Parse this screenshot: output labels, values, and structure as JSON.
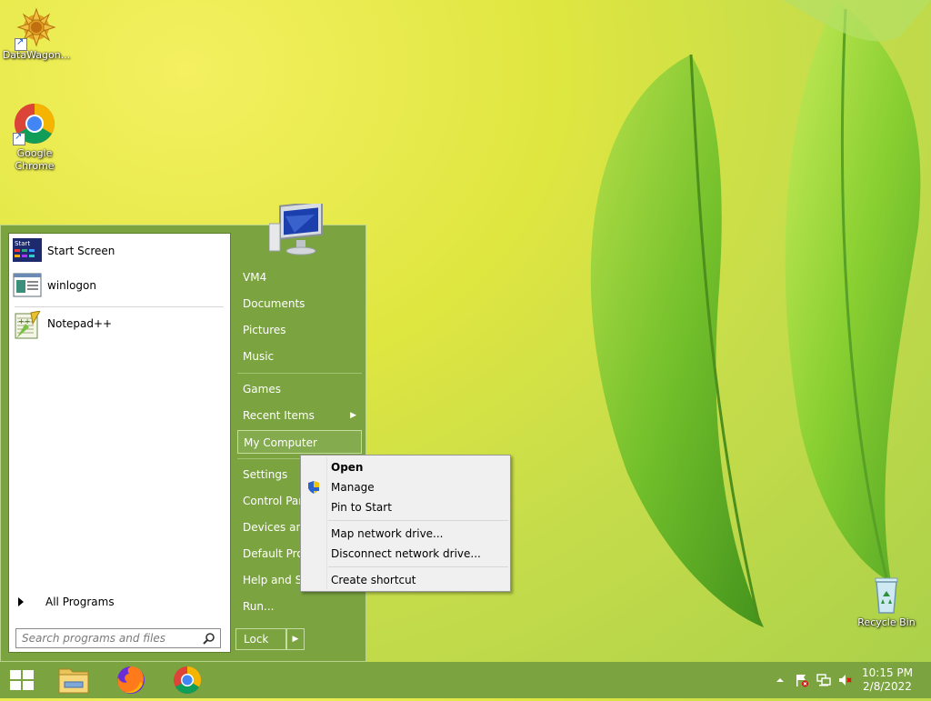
{
  "desktop": {
    "icons": [
      {
        "label": "DataWagon...",
        "icon": "datawagon-icon"
      },
      {
        "label": "Google Chrome",
        "icon": "chrome-icon"
      },
      {
        "label": "Recycle Bin",
        "icon": "recycle-bin-icon"
      }
    ]
  },
  "start_menu": {
    "programs": [
      {
        "label": "Start Screen",
        "icon": "start-screen-icon"
      },
      {
        "label": "winlogon",
        "icon": "winlogon-icon"
      },
      {
        "label": "Notepad++",
        "icon": "notepadpp-icon"
      }
    ],
    "all_programs_label": "All Programs",
    "search_placeholder": "Search programs and files",
    "right_items": [
      {
        "label": "VM4"
      },
      {
        "label": "Documents"
      },
      {
        "label": "Pictures"
      },
      {
        "label": "Music"
      },
      {
        "label": "Games"
      },
      {
        "label": "Recent Items"
      },
      {
        "label": "My Computer"
      },
      {
        "label": "Settings"
      },
      {
        "label": "Control Pan"
      },
      {
        "label": "Devices and"
      },
      {
        "label": "Default Prog"
      },
      {
        "label": "Help and Su"
      },
      {
        "label": "Run..."
      }
    ],
    "lock_label": "Lock"
  },
  "context_menu": {
    "items": [
      {
        "label": "Open",
        "bold": true
      },
      {
        "label": "Manage",
        "icon": "uac-shield-icon"
      },
      {
        "label": "Pin to Start"
      },
      {
        "label": "Map network drive..."
      },
      {
        "label": "Disconnect network drive..."
      },
      {
        "label": "Create shortcut"
      }
    ]
  },
  "taskbar": {
    "pinned": [
      "start-button",
      "file-explorer-icon",
      "firefox-icon",
      "chrome-icon"
    ],
    "time": "10:15 PM",
    "date": "2/8/2022"
  },
  "colors": {
    "accent": "#7ba440",
    "menu_bg": "#f0f0f0"
  }
}
